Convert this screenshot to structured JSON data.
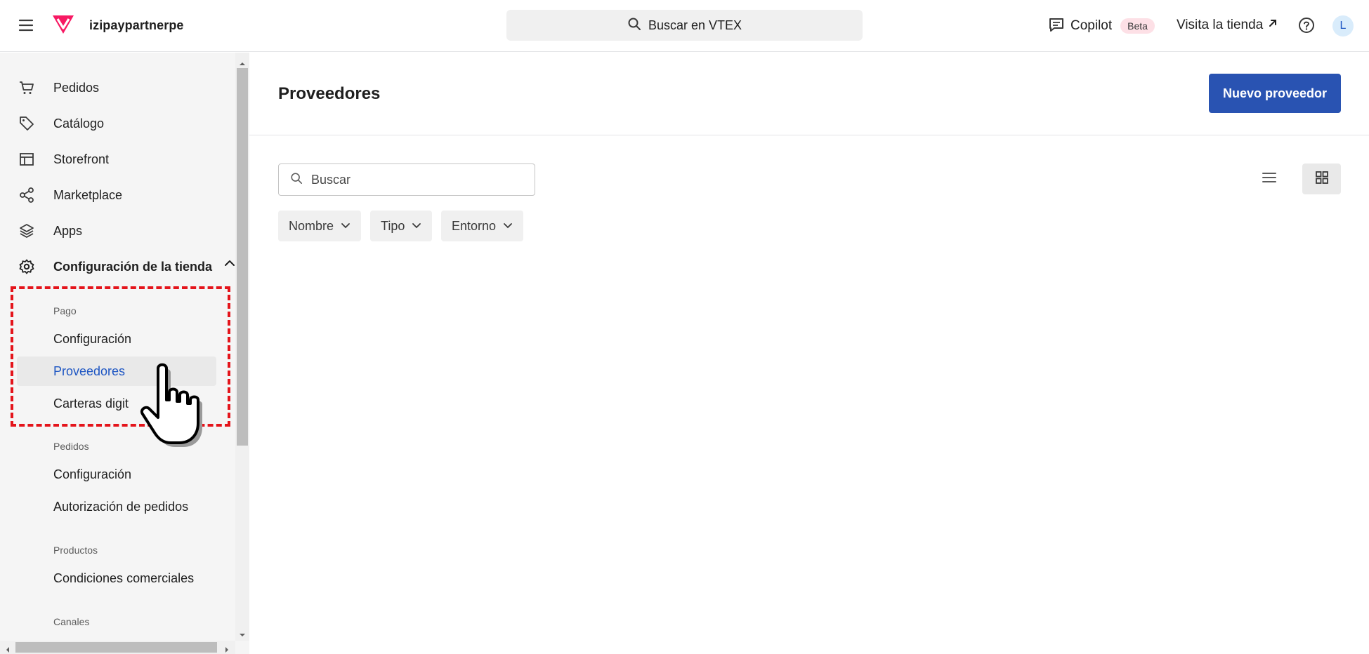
{
  "topbar": {
    "store_name": "izipaypartnerpe",
    "search_placeholder": "Buscar en VTEX",
    "copilot_label": "Copilot",
    "beta_label": "Beta",
    "visit_store_label": "Visita la tienda",
    "avatar_initial": "L"
  },
  "sidebar": {
    "items": [
      {
        "label": "Pedidos",
        "icon": "cart-icon"
      },
      {
        "label": "Catálogo",
        "icon": "tag-icon"
      },
      {
        "label": "Storefront",
        "icon": "layout-icon"
      },
      {
        "label": "Marketplace",
        "icon": "share-icon"
      },
      {
        "label": "Apps",
        "icon": "layers-icon"
      },
      {
        "label": "Configuración de la tienda",
        "icon": "gear-icon"
      }
    ],
    "sections": [
      {
        "title": "Pago",
        "items": [
          "Configuración",
          "Proveedores",
          "Carteras digit"
        ]
      },
      {
        "title": "Pedidos",
        "items": [
          "Configuración",
          "Autorización de pedidos"
        ]
      },
      {
        "title": "Productos",
        "items": [
          "Condiciones comerciales"
        ]
      },
      {
        "title": "Canales",
        "items": []
      }
    ],
    "active_item": "Proveedores"
  },
  "main": {
    "title": "Proveedores",
    "primary_button": "Nuevo proveedor",
    "search_placeholder": "Buscar",
    "filters": [
      "Nombre",
      "Tipo",
      "Entorno"
    ],
    "active_view": "grid"
  },
  "colors": {
    "brand": "#f71963",
    "primary_button": "#2953b2",
    "active_link": "#1e56c3",
    "highlight": "#e4141b"
  }
}
